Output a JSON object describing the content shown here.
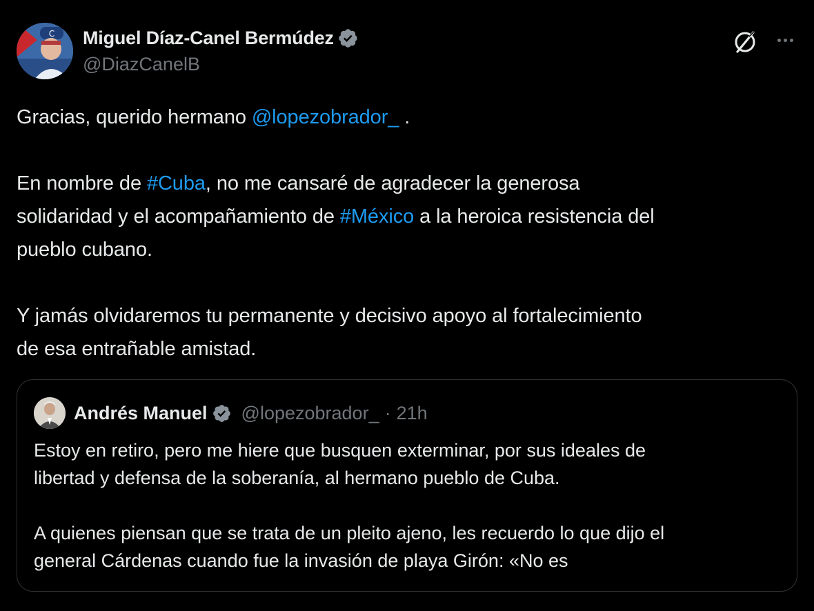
{
  "author": {
    "display_name": "Miguel Díaz-Canel Bermúdez",
    "handle": "@DiazCanelB",
    "verified": true
  },
  "icons": {
    "verified": "verified-badge-icon",
    "grok": "grok-icon",
    "more": "more-options-icon"
  },
  "colors": {
    "background": "#000000",
    "text": "#e7e9ea",
    "secondary": "#71767b",
    "link": "#1d9bf0",
    "border": "#2f3336"
  },
  "tweet": {
    "p1_text": "Gracias, querido hermano ",
    "p1_mention": "@lopezobrador_",
    "p1_end": " .",
    "p2_line1_pre": "En nombre de ",
    "p2_hashtag1": "#Cuba",
    "p2_line1_post": ", no me cansaré de agradecer la generosa",
    "p2_line2_pre": "solidaridad y el acompañamiento de ",
    "p2_hashtag2": "#México",
    "p2_line2_post": " a la heroica resistencia del",
    "p2_line3": "pueblo cubano.",
    "p3_line1": "Y jamás olvidaremos tu permanente y decisivo apoyo al fortalecimiento",
    "p3_line2": "de esa entrañable amistad."
  },
  "quoted_tweet": {
    "display_name": "Andrés Manuel",
    "handle": "@lopezobrador_",
    "separator": "·",
    "time": "21h",
    "line1": "Estoy en retiro, pero me hiere que busquen exterminar, por sus ideales de",
    "line2": "libertad y defensa de la soberanía, al hermano pueblo de Cuba.",
    "line3": "A quienes piensan que se trata de un pleito ajeno, les recuerdo lo que dijo el",
    "line4": "general Cárdenas cuando fue la invasión de playa Girón: «No es"
  }
}
